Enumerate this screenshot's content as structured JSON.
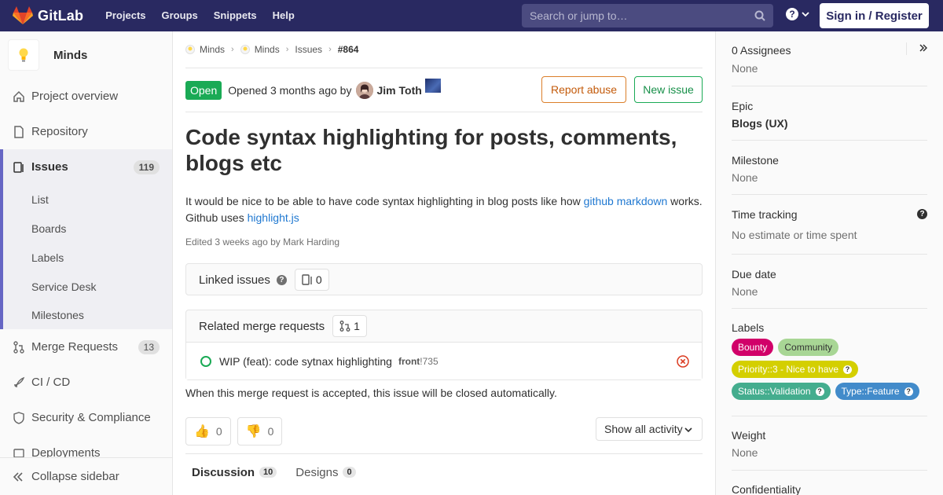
{
  "navbar": {
    "brand": "GitLab",
    "links": [
      "Projects",
      "Groups",
      "Snippets",
      "Help"
    ],
    "search_placeholder": "Search or jump to…",
    "signin": "Sign in / Register"
  },
  "sidebar": {
    "project": "Minds",
    "items": [
      {
        "label": "Project overview"
      },
      {
        "label": "Repository"
      },
      {
        "label": "Issues",
        "count": "119"
      },
      {
        "label": "Merge Requests",
        "count": "13"
      },
      {
        "label": "CI / CD"
      },
      {
        "label": "Security & Compliance"
      },
      {
        "label": "Deployments"
      }
    ],
    "issue_sub": [
      "List",
      "Boards",
      "Labels",
      "Service Desk",
      "Milestones"
    ],
    "collapse": "Collapse sidebar"
  },
  "breadcrumb": [
    "Minds",
    "Minds",
    "Issues",
    "#864"
  ],
  "issue": {
    "status": "Open",
    "opened_text": "Opened 3 months ago by",
    "author": "Jim Toth",
    "report_abuse": "Report abuse",
    "new_issue": "New issue",
    "title": "Code syntax highlighting for posts, comments, blogs etc",
    "desc_pre": "It would be nice to be able to have code syntax highlighting in blog posts like how ",
    "desc_link1": "github markdown",
    "desc_mid": " works. Github uses ",
    "desc_link2": "highlight.js",
    "edited": "Edited 3 weeks ago by Mark Harding"
  },
  "linked_issues": {
    "label": "Linked issues",
    "count": "0"
  },
  "related_mrs": {
    "label": "Related merge requests",
    "count": "1",
    "items": [
      {
        "title": "WIP (feat): code sytnax highlighting",
        "ref_proj": "front",
        "ref_num": "!735"
      }
    ],
    "note": "When this merge request is accepted, this issue will be closed automatically."
  },
  "reactions": {
    "thumbsup": "0",
    "thumbsdown": "0",
    "activity": "Show all activity"
  },
  "tabs": [
    {
      "label": "Discussion",
      "count": "10"
    },
    {
      "label": "Designs",
      "count": "0"
    }
  ],
  "right": {
    "assignees_label": "0 Assignees",
    "assignees_val": "None",
    "epic_label": "Epic",
    "epic_val": "Blogs (UX)",
    "milestone_label": "Milestone",
    "milestone_val": "None",
    "time_label": "Time tracking",
    "time_val": "No estimate or time spent",
    "due_label": "Due date",
    "due_val": "None",
    "labels_label": "Labels",
    "labels": [
      {
        "text": "Bounty",
        "bg": "#d10069",
        "fg": "#ffffff",
        "scoped": false
      },
      {
        "text": "Community",
        "bg": "#a8d695",
        "fg": "#333333",
        "scoped": false
      },
      {
        "text": "Priority::3 - Nice to have",
        "bg": "#d4cf00",
        "fg": "#ffffff",
        "scoped": true
      },
      {
        "text": "Status::Validation",
        "bg": "#44ad8e",
        "fg": "#ffffff",
        "scoped": true
      },
      {
        "text": "Type::Feature",
        "bg": "#428bca",
        "fg": "#ffffff",
        "scoped": true
      }
    ],
    "weight_label": "Weight",
    "weight_val": "None",
    "confidentiality_label": "Confidentiality"
  }
}
